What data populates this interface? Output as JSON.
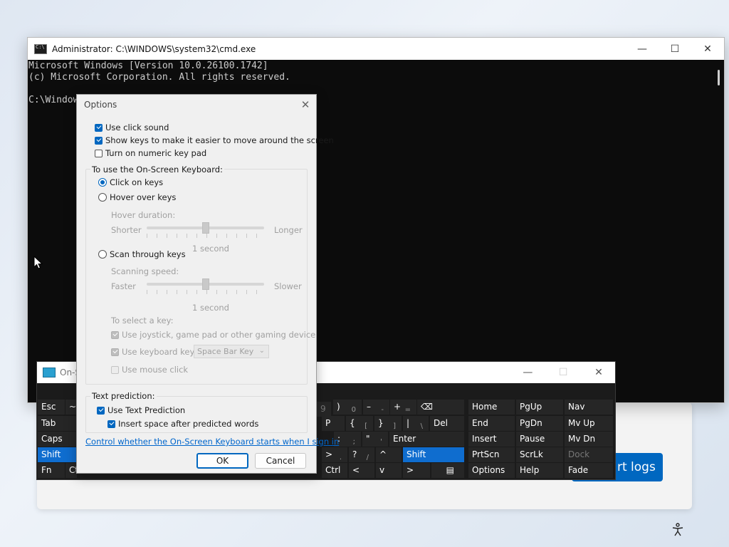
{
  "background_app": {
    "export_button_label": "rt logs"
  },
  "cmd": {
    "title": "Administrator: C:\\WINDOWS\\system32\\cmd.exe",
    "lines": [
      "Microsoft Windows [Version 10.0.26100.1742]",
      "(c) Microsoft Corporation. All rights reserved.",
      "",
      "C:\\Window"
    ],
    "controls": {
      "minimize": "—",
      "maximize": "☐",
      "close": "✕"
    }
  },
  "osk": {
    "title": "On-S",
    "controls": {
      "minimize": "—",
      "maximize": "☐",
      "close": "✕"
    },
    "keys": {
      "esc": "Esc",
      "tilde": "~",
      "tab": "Tab",
      "caps": "Caps",
      "shift_left": "Shift",
      "fn": "Fn",
      "ctrl_left": "Ct",
      "nine": "9",
      "paren_close": ")",
      "zero": "0",
      "minus": "–",
      "minus_sub": "-",
      "plus": "+",
      "equals": "=",
      "backspace": "⌫",
      "p": "P",
      "brace_open": "{",
      "bracket_open": "[",
      "brace_close": "}",
      "bracket_close": "]",
      "pipe": "|",
      "backslash": "\\",
      "del": "Del",
      "colon": ":",
      "semicolon": ";",
      "quote": "\"",
      "apostrophe": "'",
      "enter": "Enter",
      "greater": ">",
      "period": ".",
      "question": "?",
      "slash": "/",
      "up": "^",
      "shift_right": "Shift",
      "ctrl_right": "Ctrl",
      "left": "<",
      "down": "v",
      "right": ">",
      "menu": "▤",
      "home": "Home",
      "pgup": "PgUp",
      "nav": "Nav",
      "end": "End",
      "pgdn": "PgDn",
      "mvup": "Mv Up",
      "insert": "Insert",
      "pause": "Pause",
      "mvdn": "Mv Dn",
      "prtscn": "PrtScn",
      "scrlk": "ScrLk",
      "dock": "Dock",
      "options": "Options",
      "help": "Help",
      "fade": "Fade"
    }
  },
  "options": {
    "title": "Options",
    "close": "✕",
    "use_click_sound": {
      "label": "Use click sound",
      "checked": true
    },
    "show_keys": {
      "label": "Show keys to make it easier to move around the screen",
      "checked": true
    },
    "numeric_pad": {
      "label": "Turn on numeric key pad",
      "checked": false
    },
    "use_group_label": "To use the On-Screen Keyboard:",
    "click_on_keys": {
      "label": "Click on keys",
      "selected": true
    },
    "hover_over_keys": {
      "label": "Hover over keys",
      "selected": false
    },
    "hover_duration": {
      "label": "Hover duration:",
      "min_label": "Shorter",
      "max_label": "Longer",
      "value_text": "1 second",
      "level": 0.5
    },
    "scan_through_keys": {
      "label": "Scan through keys",
      "selected": false
    },
    "scanning_speed": {
      "label": "Scanning speed:",
      "min_label": "Faster",
      "max_label": "Slower",
      "value_text": "1 second",
      "level": 0.5
    },
    "select_key_label": "To select a key:",
    "use_joystick": {
      "label": "Use joystick, game pad or other gaming device",
      "checked": true
    },
    "use_keyboard_key": {
      "label": "Use keyboard key",
      "checked": true
    },
    "keyboard_key_value": "Space Bar Key",
    "use_mouse_click": {
      "label": "Use mouse click",
      "checked": false
    },
    "text_prediction_label": "Text prediction:",
    "use_text_prediction": {
      "label": "Use Text Prediction",
      "checked": true
    },
    "insert_space": {
      "label": "Insert space after predicted words",
      "checked": true
    },
    "signin_link": "Control whether the On-Screen Keyboard starts when I sign in",
    "ok_label": "OK",
    "cancel_label": "Cancel"
  }
}
